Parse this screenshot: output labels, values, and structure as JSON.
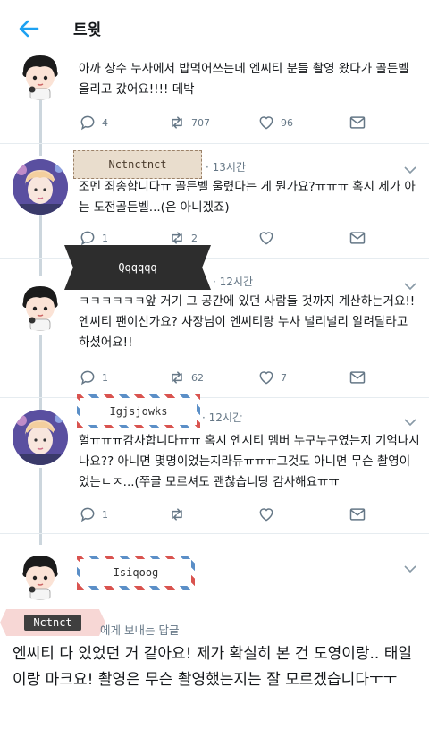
{
  "header": {
    "title": "트윗"
  },
  "tweets": [
    {
      "text": "아까 상수 누사에서 밥먹어쓰는데 엔씨티 분들 촬영 왔다가 골든벨 울리고 갔어요!!!! 데박",
      "replies": "4",
      "retweets": "707",
      "likes": "96"
    },
    {
      "name": "Nctnctnct",
      "time": "13시간",
      "text": "조멘 죄송합니다ㅠ 골든벨 울렸다는 게 뭔가요?ㅠㅠㅠ 혹시 제가 아는 도전골든벨...(은 아니겠죠)",
      "replies": "1",
      "retweets": "2",
      "likes": ""
    },
    {
      "name": "Qqqqqq",
      "time": "12시간",
      "text": "ㅋㅋㅋㅋㅋㅋ앞 거기 그 공간에 있던 사람들 것까지 계산하는거요!! 엔씨티 팬이신가요? 사장님이 엔씨티랑 누사 널리널리 알려달라고 하셨어요!!",
      "replies": "1",
      "retweets": "62",
      "likes": "7"
    },
    {
      "name": "Igjsjowks",
      "time": "12시간",
      "text": "헐ㅠㅠㅠ감사합니다ㅠㅠ 혹시 엔시티 멤버 누구누구였는지 기억나시나요?? 아니면 몇명이었는지라듀ㅠㅠㅠ그것도 아니면 무슨 촬영이었는ㄴㅈ...(쭈글 모르셔도 괜찮습니당 감사해요ㅠㅠ",
      "replies": "1",
      "retweets": "",
      "likes": ""
    },
    {
      "name": "Isiqoog",
      "reply_label": "Nctnct",
      "reply_to": "에게 보내는 답글",
      "text": "엔씨티 다 있었던 거 같아요! 제가 확실히 본 건 도영이랑.. 태일이랑 마크요! 촬영은 무슨 촬영했는지는 잘 모르겠습니다ㅜㅜ"
    }
  ],
  "colors": {
    "accent": "#1da1f2",
    "icon": "#657786",
    "line": "#ccd6dd"
  }
}
